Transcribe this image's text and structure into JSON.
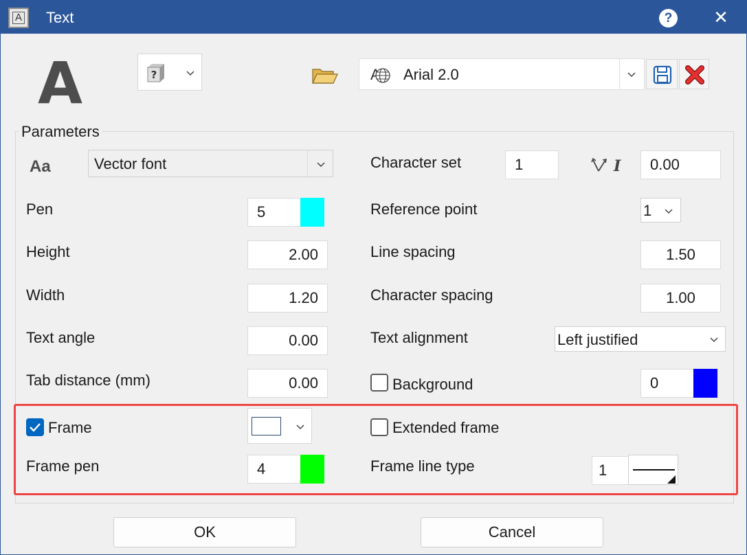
{
  "window": {
    "title": "Text",
    "app_icon_glyph": "A",
    "help_glyph": "?",
    "close_glyph": "✕",
    "titlebar_color": "#2b579a"
  },
  "top": {
    "big_glyph": "A",
    "preset_icon": "unknown-preset-cube-icon",
    "font_glyph": "A",
    "font_name": "Arial 2.0"
  },
  "parameters": {
    "group_label": "Parameters",
    "font_type_icon_text": "Aa",
    "font_type": "Vector font",
    "pen": {
      "label": "Pen",
      "value": "5",
      "color": "#00ffff"
    },
    "height": {
      "label": "Height",
      "value": "2.00"
    },
    "width": {
      "label": "Width",
      "value": "1.20"
    },
    "text_angle": {
      "label": "Text angle",
      "value": "0.00"
    },
    "tab_distance": {
      "label": "Tab distance (mm)",
      "value": "0.00"
    },
    "character_set": {
      "label": "Character set",
      "value": "1"
    },
    "italic_angle": {
      "icon": "italic-slant-icon",
      "value": "0.00"
    },
    "reference_point": {
      "label": "Reference point",
      "value": "1"
    },
    "line_spacing": {
      "label": "Line spacing",
      "value": "1.50"
    },
    "character_spacing": {
      "label": "Character spacing",
      "value": "1.00"
    },
    "text_alignment": {
      "label": "Text alignment",
      "value": "Left justified"
    },
    "background": {
      "label": "Background",
      "checked": false,
      "value": "0",
      "color": "#0000ff"
    },
    "frame": {
      "label": "Frame",
      "checked": true
    },
    "frame_pen": {
      "label": "Frame pen",
      "value": "4",
      "color": "#00ff00"
    },
    "extended_frame": {
      "label": "Extended frame",
      "checked": false
    },
    "frame_line_type": {
      "label": "Frame line type",
      "value": "1"
    }
  },
  "buttons": {
    "ok": "OK",
    "cancel": "Cancel"
  },
  "highlight_color": "#ee4444"
}
